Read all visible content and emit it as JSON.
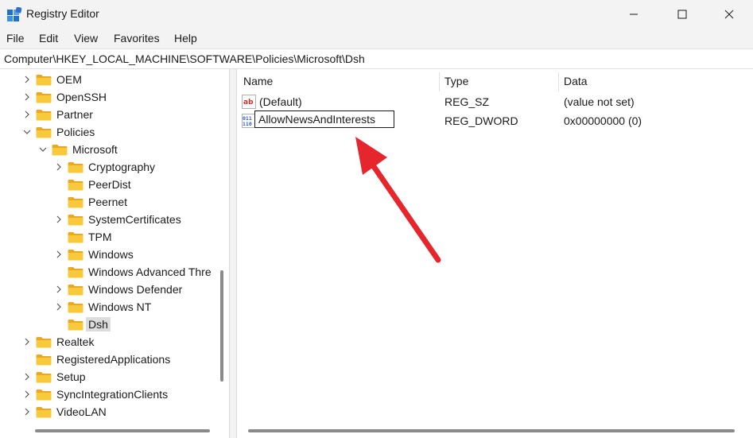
{
  "window": {
    "title": "Registry Editor",
    "icon": "registry-editor-icon",
    "controls": {
      "minimize": "minimize-icon",
      "maximize": "maximize-icon",
      "close": "close-icon"
    }
  },
  "menu": [
    "File",
    "Edit",
    "View",
    "Favorites",
    "Help"
  ],
  "address": "Computer\\HKEY_LOCAL_MACHINE\\SOFTWARE\\Policies\\Microsoft\\Dsh",
  "tree": [
    {
      "label": "OEM",
      "expander": "collapsed"
    },
    {
      "label": "OpenSSH",
      "expander": "collapsed"
    },
    {
      "label": "Partner",
      "expander": "collapsed"
    },
    {
      "label": "Policies",
      "expander": "expanded"
    },
    {
      "label": "Microsoft",
      "expander": "expanded"
    },
    {
      "label": "Cryptography",
      "expander": "collapsed"
    },
    {
      "label": "PeerDist",
      "expander": "none"
    },
    {
      "label": "Peernet",
      "expander": "none"
    },
    {
      "label": "SystemCertificates",
      "expander": "collapsed"
    },
    {
      "label": "TPM",
      "expander": "none"
    },
    {
      "label": "Windows",
      "expander": "collapsed"
    },
    {
      "label": "Windows Advanced Thre",
      "expander": "none"
    },
    {
      "label": "Windows Defender",
      "expander": "collapsed"
    },
    {
      "label": "Windows NT",
      "expander": "collapsed"
    },
    {
      "label": "Dsh",
      "expander": "none",
      "selected": true
    },
    {
      "label": "Realtek",
      "expander": "collapsed"
    },
    {
      "label": "RegisteredApplications",
      "expander": "none"
    },
    {
      "label": "Setup",
      "expander": "collapsed"
    },
    {
      "label": "SyncIntegrationClients",
      "expander": "collapsed"
    },
    {
      "label": "VideoLAN",
      "expander": "collapsed"
    }
  ],
  "list": {
    "columns": [
      "Name",
      "Type",
      "Data"
    ],
    "rows": [
      {
        "name": "(Default)",
        "type": "REG_SZ",
        "data": "(value not set)",
        "icon": "string-value-icon"
      },
      {
        "name": "AllowNewsAndInterests",
        "type": "REG_DWORD",
        "data": "0x00000000 (0)",
        "icon": "dword-value-icon",
        "editing": true
      }
    ]
  },
  "colors": {
    "folder": "#f9c93c",
    "folder_dark": "#e8a920",
    "arrow": "#e5262c",
    "accent": "#2f6fd0"
  }
}
